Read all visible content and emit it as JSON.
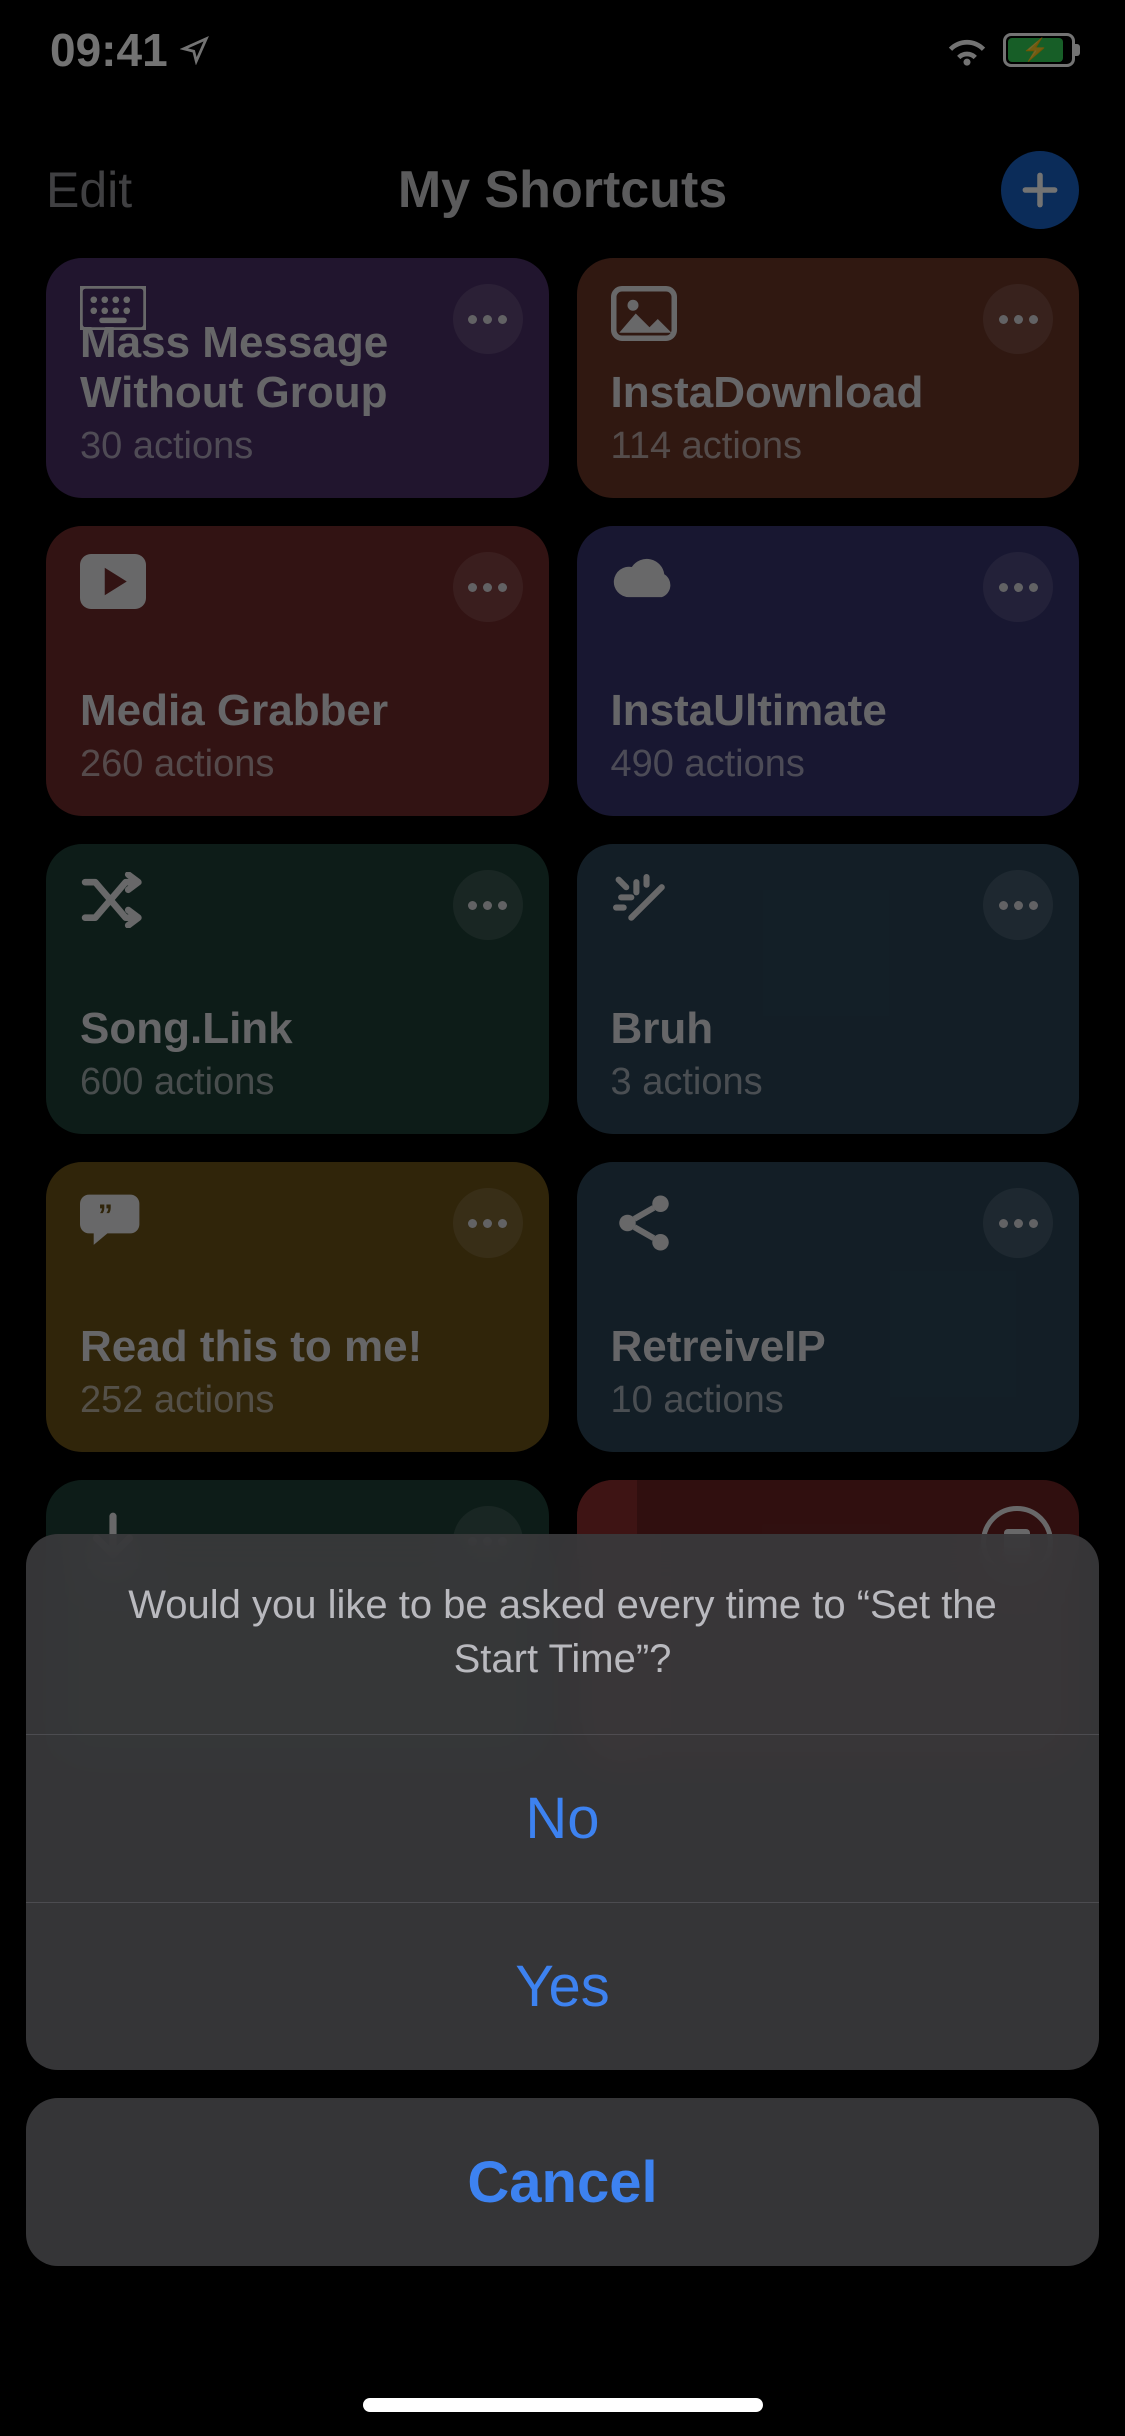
{
  "status": {
    "time": "09:41"
  },
  "nav": {
    "edit": "Edit",
    "title": "My Shortcuts"
  },
  "shortcuts": [
    {
      "title": "Mass Message Without Group",
      "sub": "30 actions",
      "color": "c-purple",
      "icon": "keyboard"
    },
    {
      "title": "InstaDownload",
      "sub": "114 actions",
      "color": "c-orange",
      "icon": "image"
    },
    {
      "title": "Media Grabber",
      "sub": "260 actions",
      "color": "c-red",
      "icon": "play"
    },
    {
      "title": "InstaUltimate",
      "sub": "490 actions",
      "color": "c-indigo",
      "icon": "cloud"
    },
    {
      "title": "Song.Link",
      "sub": "600 actions",
      "color": "c-teal",
      "icon": "shuffle"
    },
    {
      "title": "Bruh",
      "sub": "3 actions",
      "color": "c-blue",
      "icon": "wand"
    },
    {
      "title": "Read this to me!",
      "sub": "252 actions",
      "color": "c-yellow",
      "icon": "quote"
    },
    {
      "title": "RetreiveIP",
      "sub": "10 actions",
      "color": "c-blue2",
      "icon": "share"
    },
    {
      "title": "",
      "sub": "",
      "color": "c-teal2",
      "icon": "download"
    },
    {
      "title": "",
      "sub": "",
      "color": "c-red2",
      "icon": "stop"
    }
  ],
  "sheet": {
    "message": "Would you like to be asked every time to “Set the Start Time”?",
    "no": "No",
    "yes": "Yes",
    "cancel": "Cancel"
  }
}
